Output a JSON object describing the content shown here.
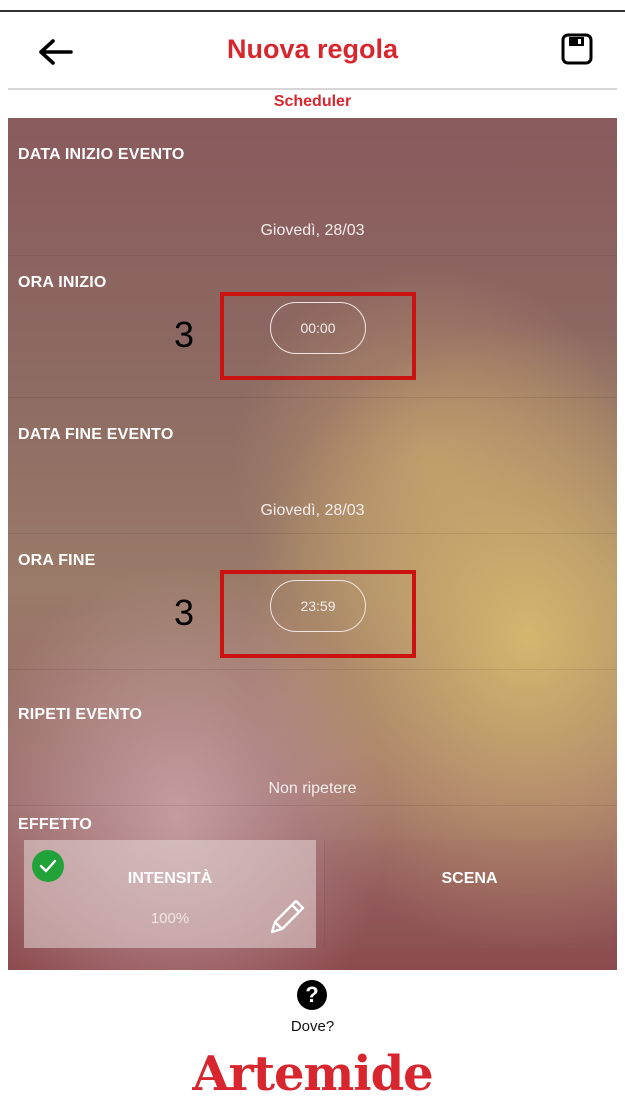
{
  "header": {
    "title": "Nuova regola",
    "back_icon": "arrow-left-icon",
    "save_icon": "floppy-disk-icon"
  },
  "subtitle": "Scheduler",
  "rows": {
    "start_date": {
      "label": "DATA INIZIO EVENTO",
      "value": "Giovedì, 28/03"
    },
    "start_time": {
      "label": "ORA INIZIO",
      "value": "00:00"
    },
    "end_date": {
      "label": "DATA FINE EVENTO",
      "value": "Giovedì, 28/03"
    },
    "end_time": {
      "label": "ORA FINE",
      "value": "23:59"
    },
    "repeat": {
      "label": "RIPETI EVENTO",
      "value": "Non ripetere"
    }
  },
  "annotations": {
    "start_time": "3",
    "end_time": "3"
  },
  "effect": {
    "label": "EFFETTO",
    "intensity": {
      "label": "INTENSITÀ",
      "value": "100%",
      "selected": true
    },
    "scene": {
      "label": "SCENA"
    }
  },
  "footer": {
    "help_icon": "question-circle-icon",
    "location_label": "Dove?",
    "logo": "Artemide"
  },
  "colors": {
    "accent": "#d8262e",
    "check": "#21a33a",
    "annotation": "#cc1111"
  }
}
